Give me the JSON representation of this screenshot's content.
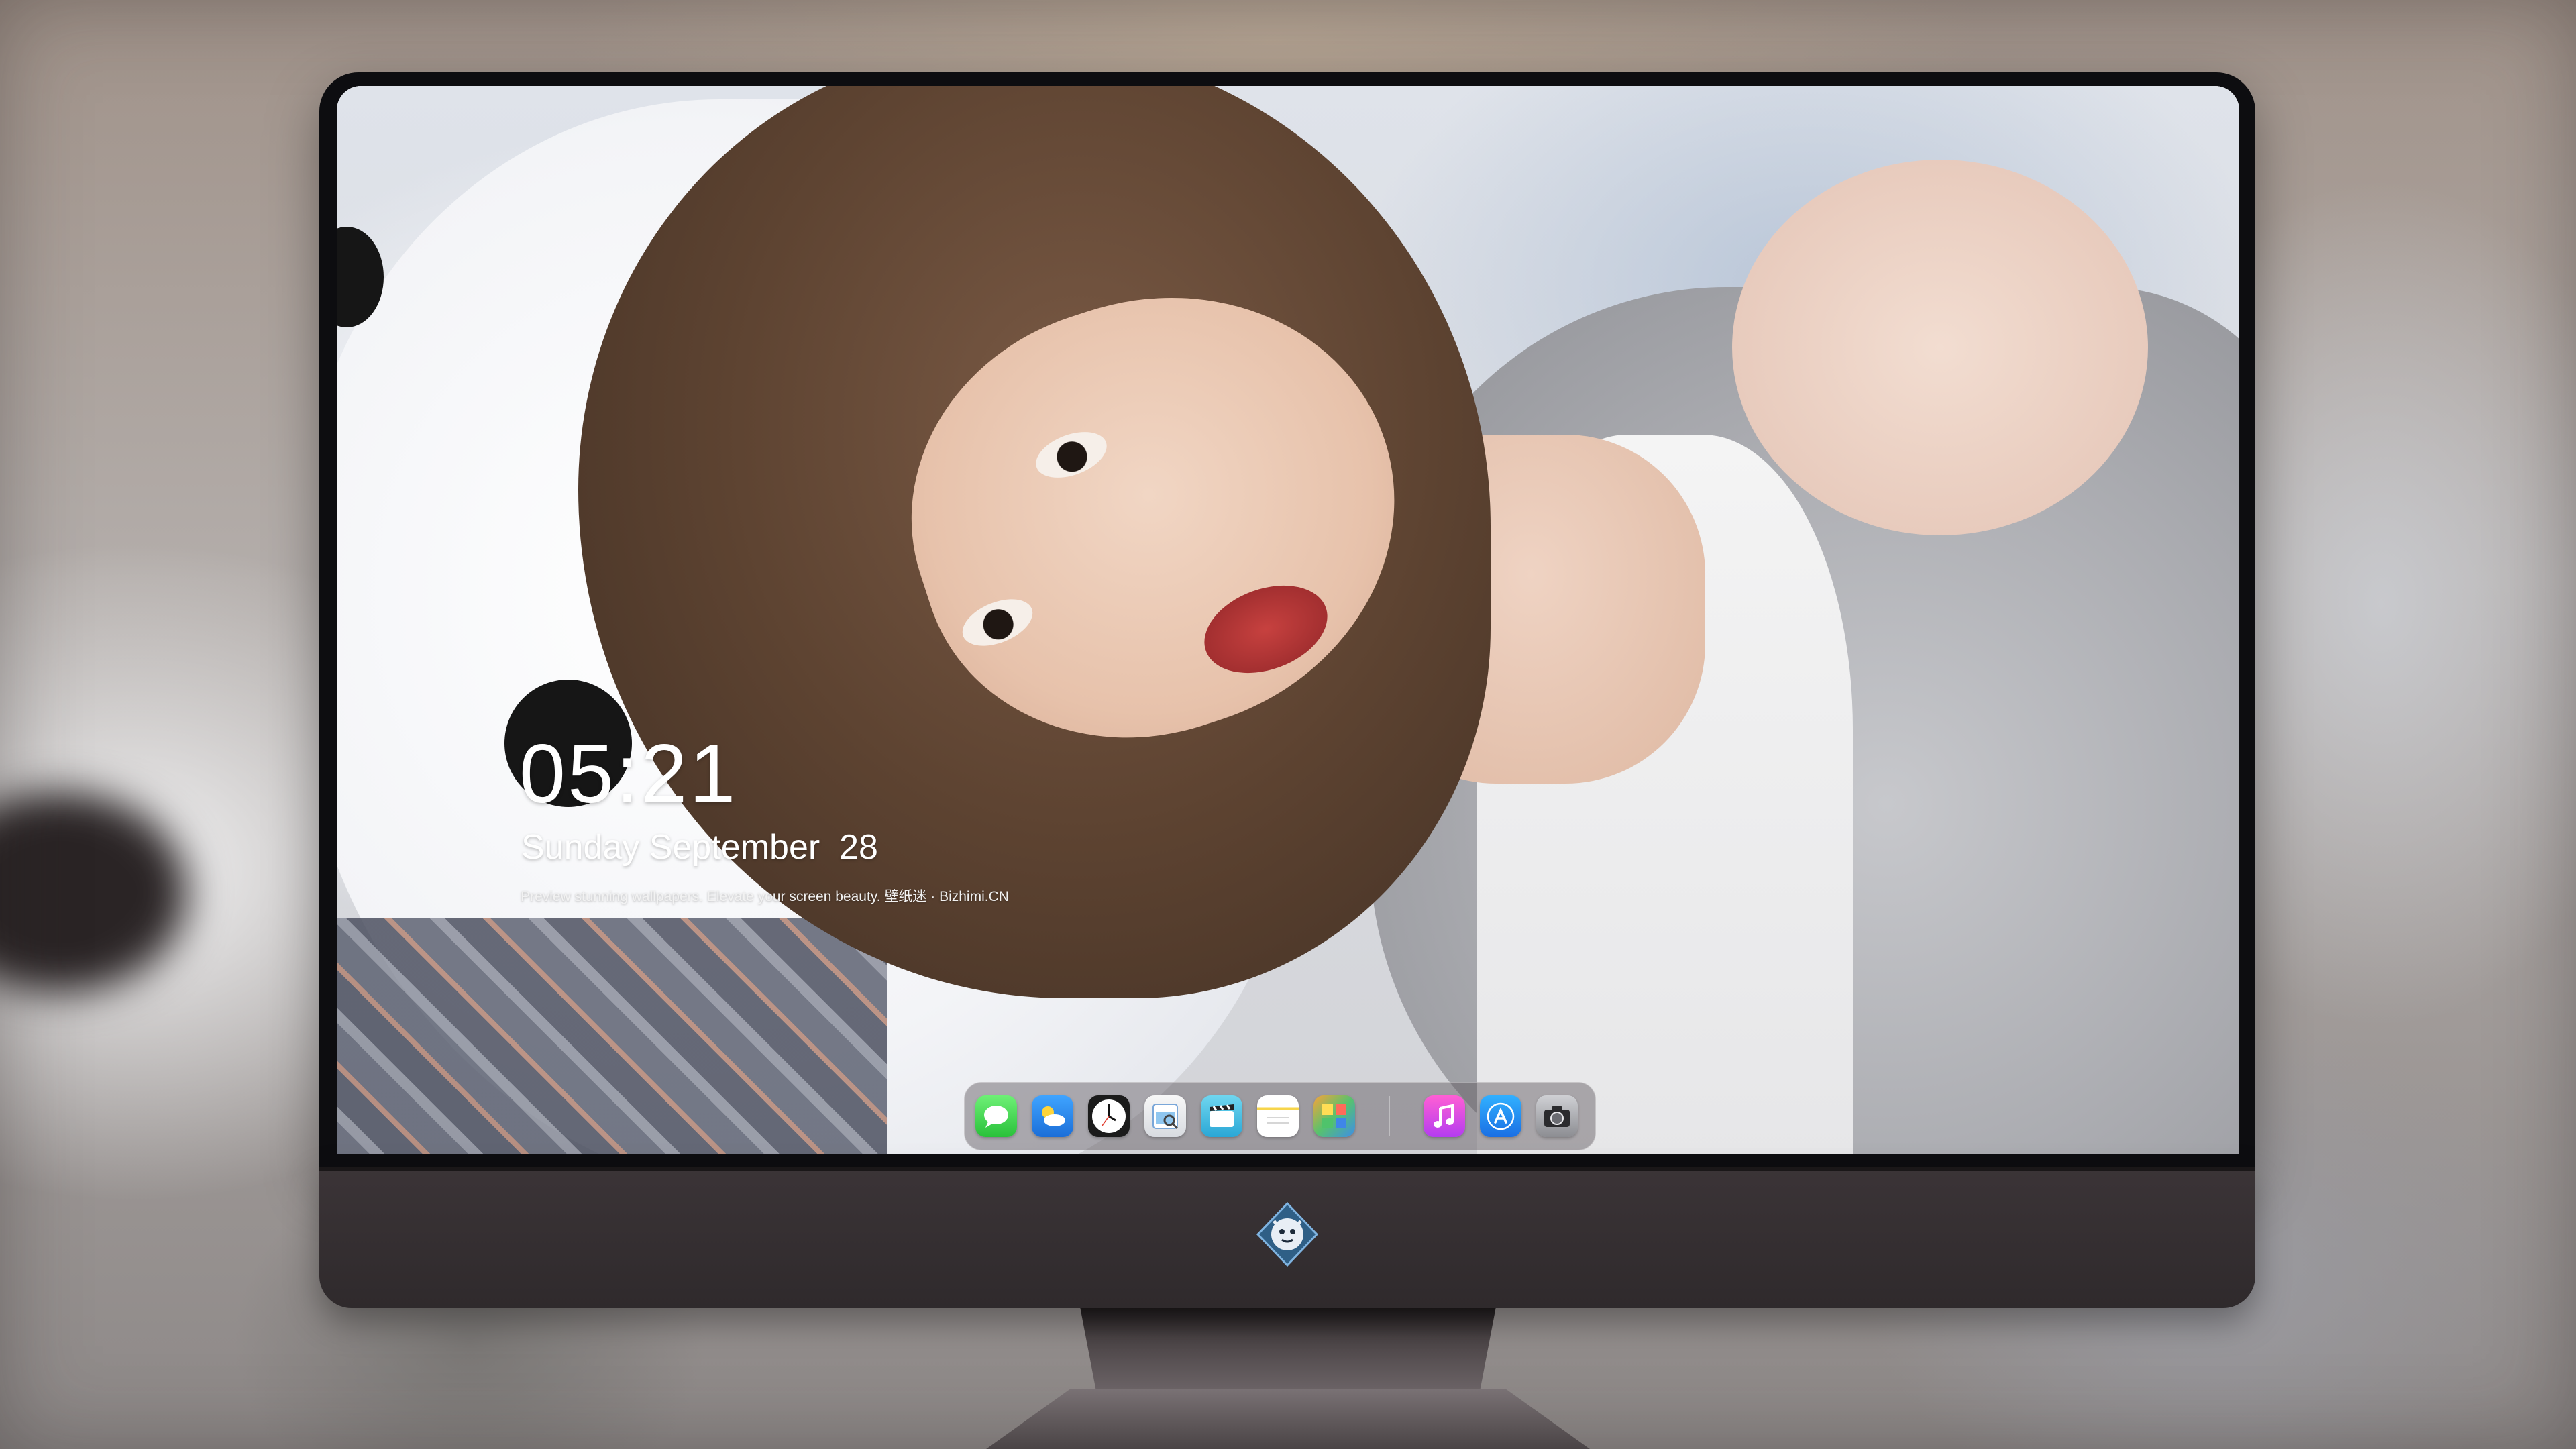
{
  "lock_screen": {
    "time": "05:21",
    "date": "Sunday September  28",
    "tagline": "Preview stunning wallpapers. Elevate your screen beauty. 壁纸迷 · Bizhimi.CN"
  },
  "dock": {
    "apps": [
      {
        "name": "messages-icon"
      },
      {
        "name": "weather-icon"
      },
      {
        "name": "clock-icon"
      },
      {
        "name": "preview-icon"
      },
      {
        "name": "clips-icon"
      },
      {
        "name": "notes-icon"
      },
      {
        "name": "photos-icon"
      },
      {
        "name": "music-icon"
      },
      {
        "name": "app-store-icon"
      },
      {
        "name": "camera-icon"
      }
    ]
  },
  "colors": {
    "monitor_bezel": "#0d0d10",
    "monitor_chin": "#342e31",
    "text": "#ffffff"
  }
}
